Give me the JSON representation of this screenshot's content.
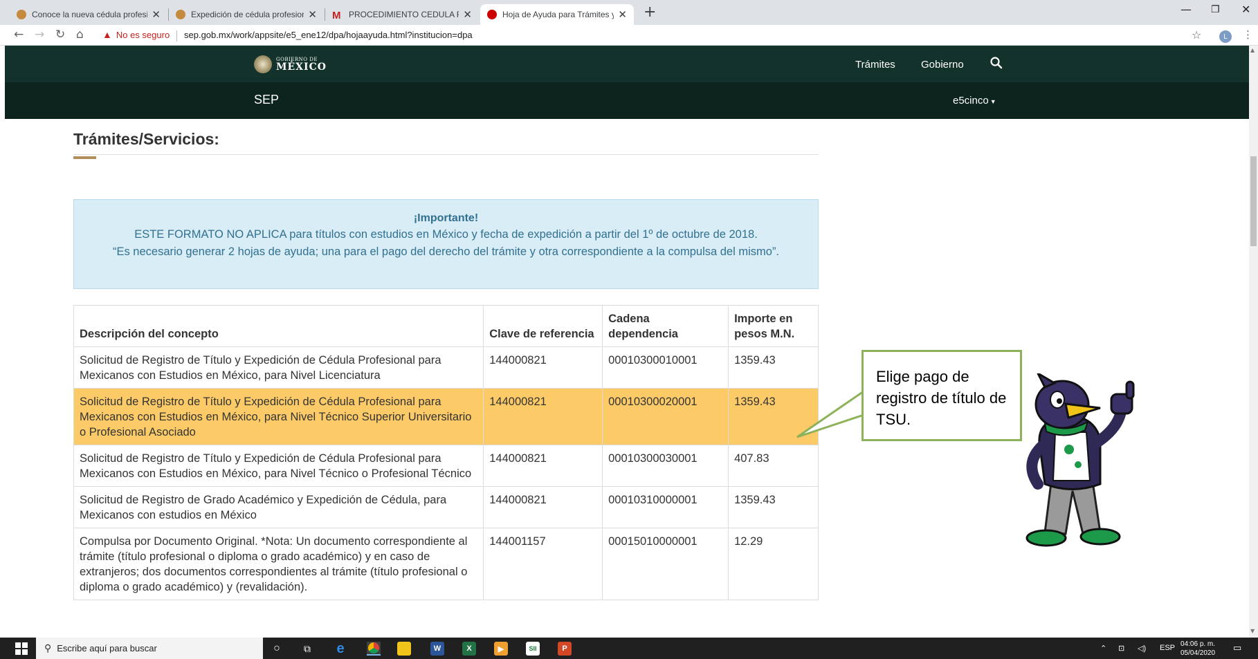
{
  "browser": {
    "tabs": [
      {
        "title": "Conoce la nueva cédula profesio",
        "favicon_color": "#c48a3d"
      },
      {
        "title": "Expedición de cédula profesional",
        "favicon_color": "#c48a3d"
      },
      {
        "title": "PROCEDIMIENTO CEDULA FEDER",
        "favicon_color": "#c5221f"
      },
      {
        "title": "Hoja de Ayuda para Trámites y S",
        "favicon_color": "#cc0000"
      }
    ],
    "not_secure_label": "No es seguro",
    "url": "sep.gob.mx/work/appsite/e5_ene12/dpa/hojaayuda.html?institucion=dpa",
    "profile_initial": "L"
  },
  "gov_header": {
    "logo_line1": "GOBIERNO DE",
    "logo_line2": "MÉXICO",
    "nav": [
      "Trámites",
      "Gobierno"
    ]
  },
  "sep_header": {
    "title": "SEP",
    "menu_label": "e5cinco"
  },
  "page": {
    "title": "Trámites/Servicios:"
  },
  "alert": {
    "heading": "¡Importante!",
    "line1": "ESTE FORMATO NO APLICA para títulos con estudios en México y fecha de expedición a partir del 1º de octubre de 2018.",
    "line2": "“Es necesario generar 2 hojas de ayuda; una para el pago del derecho del trámite y otra correspondiente a la compulsa del mismo”."
  },
  "table": {
    "headers": [
      "Descripción del concepto",
      "Clave de referencia",
      "Cadena dependencia",
      "Importe en pesos M.N."
    ],
    "rows": [
      [
        "Solicitud de Registro de Título y Expedición de Cédula Profesional para Mexicanos con Estudios en México, para Nivel Licenciatura",
        "144000821",
        "00010300010001",
        "1359.43"
      ],
      [
        "Solicitud de Registro de Título y Expedición de Cédula Profesional para Mexicanos con Estudios en México, para Nivel Técnico Superior Universitario o Profesional Asociado",
        "144000821",
        "00010300020001",
        "1359.43"
      ],
      [
        "Solicitud de Registro de Título y Expedición de Cédula Profesional para Mexicanos con Estudios en México, para Nivel Técnico o Profesional Técnico",
        "144000821",
        "00010300030001",
        "407.83"
      ],
      [
        "Solicitud de Registro de Grado Académico y Expedición de Cédula, para Mexicanos con estudios en México",
        "144000821",
        "00010310000001",
        "1359.43"
      ],
      [
        "Compulsa por Documento Original. *Nota: Un documento correspondiente al trámite (título profesional o diploma o grado académico) y en caso de extranjeros; dos documentos correspondientes al trámite (título profesional o diploma o grado académico) y (revalidación).",
        "144001157",
        "00015010000001",
        "12.29"
      ]
    ],
    "highlight_color": "#fccb68"
  },
  "callout": {
    "text": "Elige pago de registro de título de TSU.",
    "border_color": "#8db259"
  },
  "taskbar": {
    "search_placeholder": "Escribe aquí para buscar",
    "language": "ESP",
    "time": "04:06 p. m.",
    "date": "05/04/2020"
  },
  "colors": {
    "gov_green": "#13322b",
    "sep_green": "#0c231e",
    "title_accent": "#b38e5d",
    "alert_bg": "#d9edf7",
    "alert_text": "#31708f"
  }
}
